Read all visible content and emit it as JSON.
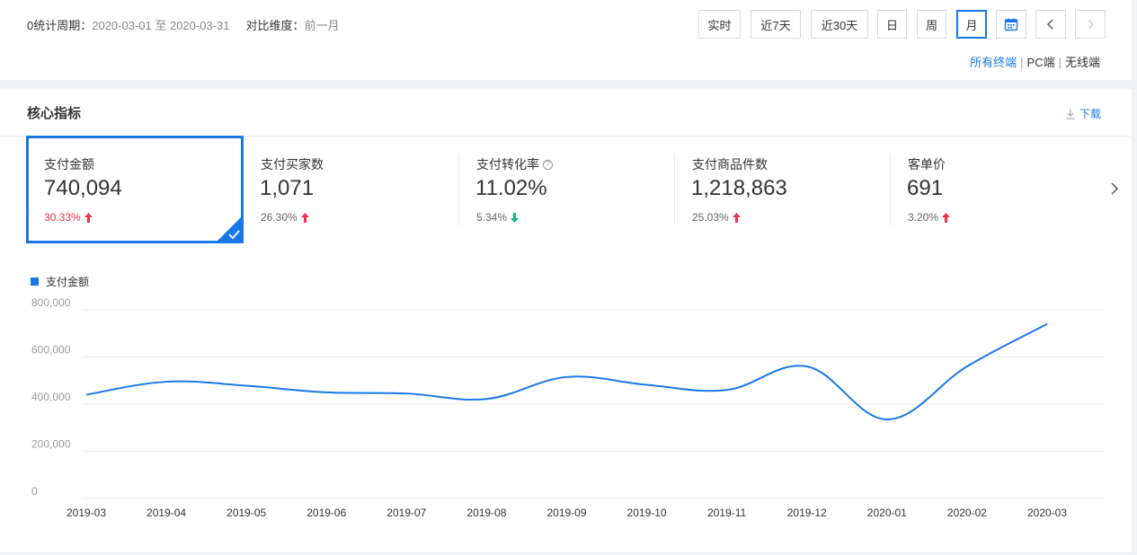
{
  "header": {
    "period_prefix": "0统计周期：",
    "period_range": "2020-03-01 至 2020-03-31",
    "compare_label": "对比维度：",
    "compare_value": "前一月",
    "period_buttons": [
      {
        "label": "实时"
      },
      {
        "label": "近7天"
      },
      {
        "label": "近30天"
      },
      {
        "label": "日"
      },
      {
        "label": "周"
      },
      {
        "label": "月",
        "active": true
      }
    ],
    "calendar_icon": "calendar-icon",
    "prev_icon": "chevron-left-icon",
    "next_icon": "chevron-right-icon",
    "terminals": [
      {
        "label": "所有终端",
        "selected": true
      },
      {
        "label": "PC端"
      },
      {
        "label": "无线端"
      }
    ]
  },
  "core": {
    "title": "核心指标",
    "download_label": "下载",
    "metrics": [
      {
        "label": "支付金额",
        "value": "740,094",
        "change": "30.33%",
        "trend": "up",
        "selected": true
      },
      {
        "label": "支付买家数",
        "value": "1,071",
        "change": "26.30%",
        "trend": "up"
      },
      {
        "label": "支付转化率",
        "value": "11.02%",
        "change": "5.34%",
        "trend": "down",
        "help": true
      },
      {
        "label": "支付商品件数",
        "value": "1,218,863",
        "change": "25.03%",
        "trend": "up"
      },
      {
        "label": "客单价",
        "value": "691",
        "change": "3.20%",
        "trend": "up"
      }
    ]
  },
  "colors": {
    "accent": "#1a78e6",
    "up": "#e8334a",
    "down": "#18b57a"
  },
  "chart_data": {
    "type": "line",
    "legend": [
      "支付金额"
    ],
    "legend_position": "top-left",
    "grid": true,
    "x": [
      "2019-03",
      "2019-04",
      "2019-05",
      "2019-06",
      "2019-07",
      "2019-08",
      "2019-09",
      "2019-10",
      "2019-11",
      "2019-12",
      "2020-01",
      "2020-02",
      "2020-03"
    ],
    "yticks": [
      "800,000",
      "600,000",
      "400,000",
      "200,000",
      "0"
    ],
    "ylim": [
      0,
      800000
    ],
    "series": [
      {
        "name": "支付金额",
        "values": [
          440000,
          495000,
          478000,
          450000,
          445000,
          422000,
          515000,
          482000,
          460000,
          560000,
          335000,
          560000,
          740094
        ]
      }
    ]
  }
}
